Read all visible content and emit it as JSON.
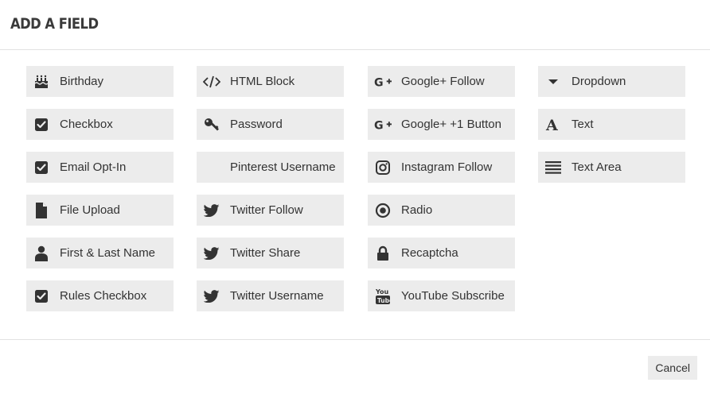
{
  "dialog": {
    "title": "ADD A FIELD"
  },
  "columns": [
    [
      {
        "label": "Birthday",
        "icon": "birthday-cake-icon"
      },
      {
        "label": "Checkbox",
        "icon": "checkbox-icon"
      },
      {
        "label": "Email Opt-In",
        "icon": "checkbox-icon"
      },
      {
        "label": "File Upload",
        "icon": "file-icon"
      },
      {
        "label": "First & Last Name",
        "icon": "user-icon"
      },
      {
        "label": "Rules Checkbox",
        "icon": "checkbox-icon"
      }
    ],
    [
      {
        "label": "HTML Block",
        "icon": "code-icon"
      },
      {
        "label": "Password",
        "icon": "key-icon"
      },
      {
        "label": "Pinterest Username",
        "icon": ""
      },
      {
        "label": "Twitter Follow",
        "icon": "twitter-icon"
      },
      {
        "label": "Twitter Share",
        "icon": "twitter-icon"
      },
      {
        "label": "Twitter Username",
        "icon": "twitter-icon"
      }
    ],
    [
      {
        "label": "Google+ Follow",
        "icon": "google-plus-icon"
      },
      {
        "label": "Google+ +1 Button",
        "icon": "google-plus-icon"
      },
      {
        "label": "Instagram Follow",
        "icon": "instagram-icon"
      },
      {
        "label": "Radio",
        "icon": "radio-icon"
      },
      {
        "label": "Recaptcha",
        "icon": "lock-icon"
      },
      {
        "label": "YouTube Subscribe",
        "icon": "youtube-icon"
      }
    ],
    [
      {
        "label": "Dropdown",
        "icon": "caret-down-icon"
      },
      {
        "label": "Text",
        "icon": "font-icon"
      },
      {
        "label": "Text Area",
        "icon": "align-justify-icon"
      }
    ]
  ],
  "footer": {
    "cancel_label": "Cancel"
  }
}
